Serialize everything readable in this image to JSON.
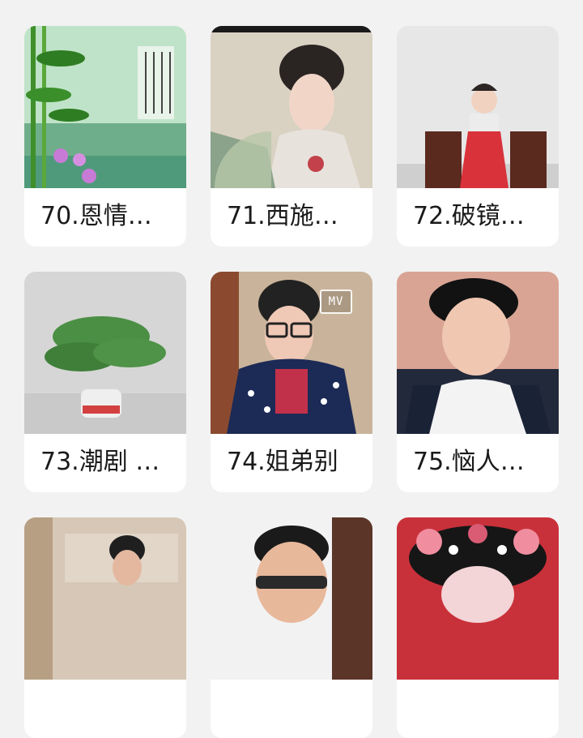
{
  "grid": {
    "items": [
      {
        "title": "70.恩情…",
        "image": "bamboo-poem-image"
      },
      {
        "title": "71.西施…",
        "image": "woman-fan-image"
      },
      {
        "title": "72.破镜…",
        "image": "child-chair-image"
      },
      {
        "title": "73.潮剧 …",
        "image": "potted-plant-image"
      },
      {
        "title": "74.姐弟别",
        "image": "woman-glasses-image",
        "badge": "MV"
      },
      {
        "title": "75.恼人…",
        "image": "young-man-image"
      },
      {
        "title": "",
        "image": "man-sofa-image"
      },
      {
        "title": "",
        "image": "man-sunglasses-image"
      },
      {
        "title": "",
        "image": "opera-headdress-image"
      }
    ]
  }
}
